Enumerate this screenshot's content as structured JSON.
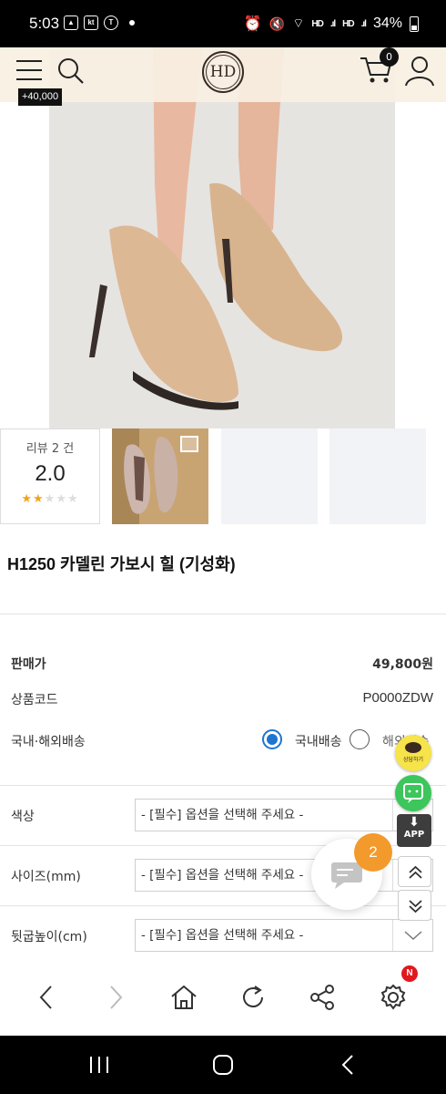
{
  "status_bar": {
    "time": "5:03",
    "notification_icons": [
      "gallery-icon",
      "kt-icon",
      "talk-icon"
    ],
    "battery": "34%",
    "signal_labels": [
      "HD",
      "HD"
    ]
  },
  "header": {
    "logo_text": "HD",
    "cart_count": "0",
    "points_badge": "+40,000"
  },
  "review_summary": {
    "count_label": "리뷰 2 건",
    "score": "2.0",
    "rating": 2,
    "max_rating": 5
  },
  "product": {
    "title": "H1250 카델린 가보시 힐 (기성화)",
    "price_label": "판매가",
    "price_value": "49,800원",
    "code_label": "상품코드",
    "code_value": "P0000ZDW",
    "shipping_label": "국내·해외배송",
    "shipping_options": [
      "국내배송",
      "해외배송"
    ],
    "shipping_selected": "국내배송"
  },
  "options": [
    {
      "label": "색상",
      "value": "- [필수] 옵션을 선택해 주세요 -"
    },
    {
      "label": "사이즈(mm)",
      "value": "- [필수] 옵션을 선택해 주세요 -"
    },
    {
      "label": "뒷굽높이(cm)",
      "value": "- [필수] 옵션을 선택해 주세요 -"
    }
  ],
  "floating": {
    "kakao_label": "상담하기",
    "app_label": "APP",
    "chat_badge": "2"
  },
  "browser_nav": {
    "settings_badge": "N"
  },
  "colors": {
    "header_bg": "#f7f0e2",
    "accent_blue": "#1f74d0",
    "star": "#f0a41c",
    "chat_badge": "#f39a2c",
    "kakao": "#f7e34a",
    "talk": "#3cc65b"
  }
}
